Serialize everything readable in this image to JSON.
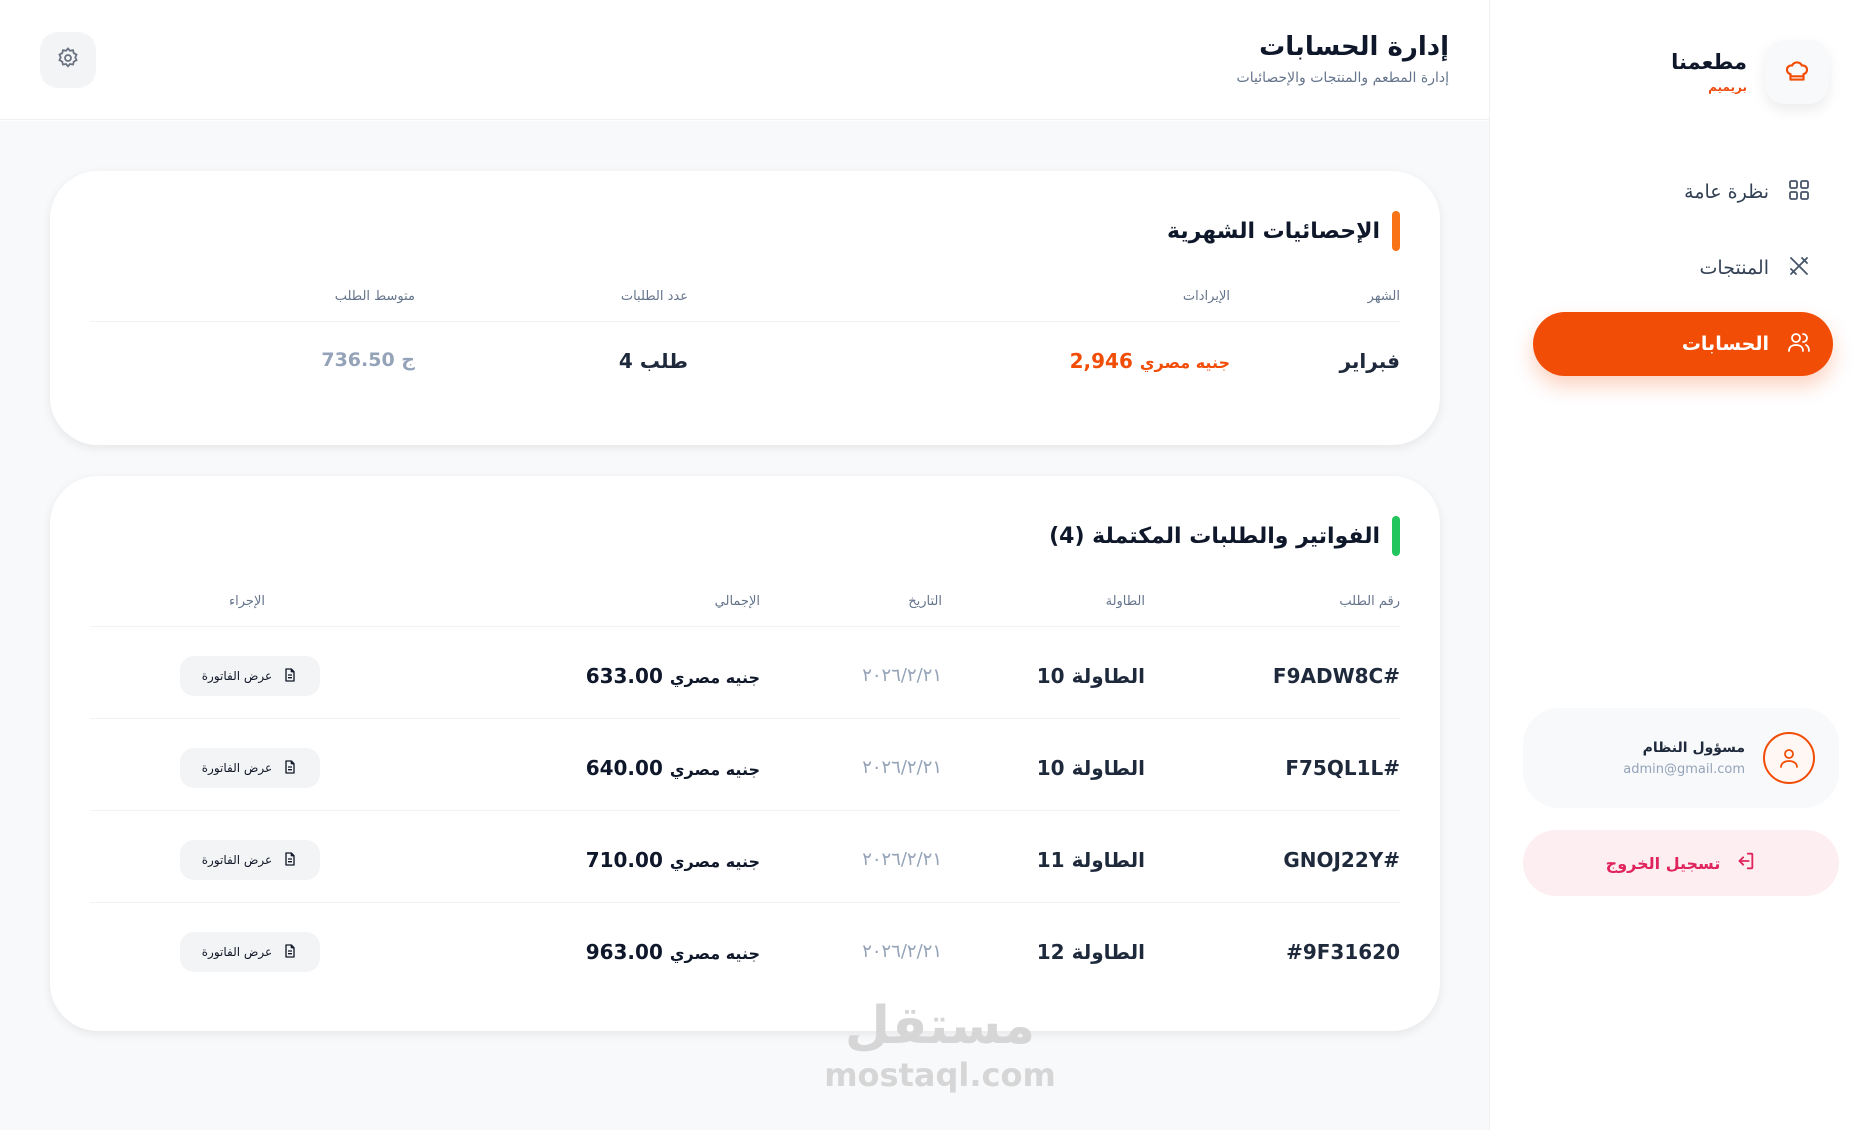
{
  "brand": {
    "name": "مطعمنا",
    "plan": "بريميم"
  },
  "nav": [
    {
      "label": "نظرة عامة",
      "icon": "grid-icon",
      "active": false
    },
    {
      "label": "المنتجات",
      "icon": "utensils-icon",
      "active": false
    },
    {
      "label": "الحسابات",
      "icon": "users-icon",
      "active": true
    }
  ],
  "user": {
    "name": "مسؤول النظام",
    "email": "admin@gmail.com"
  },
  "logout": {
    "label": "تسجيل الخروج"
  },
  "header": {
    "title": "إدارة الحسابات",
    "subtitle": "إدارة المطعم والمنتجات والإحصائيات"
  },
  "stats": {
    "title": "الإحصائيات الشهرية",
    "accent": "#f97316",
    "headers": {
      "month": "الشهر",
      "revenue": "الإيرادات",
      "orders": "عدد الطلبات",
      "avg": "متوسط الطلب"
    },
    "row": {
      "month": "فبراير",
      "revenue": "2,946",
      "revenue_unit": "جنيه مصري",
      "orders": "4 طلب",
      "avg": "736.50 ج"
    }
  },
  "orders": {
    "title": "الفواتير والطلبات المكتملة (4)",
    "accent": "#22c55e",
    "headers": {
      "id": "رقم الطلب",
      "table": "الطاولة",
      "date": "التاريخ",
      "total": "الإجمالي",
      "action": "الإجراء"
    },
    "rows": [
      {
        "id": "F9ADW8C#",
        "table": "الطاولة 10",
        "date": "٢٠٢٦/٢/٢١",
        "total": "633.00",
        "unit": "جنيه مصري",
        "action": "عرض الفاتورة"
      },
      {
        "id": "F75QL1L#",
        "table": "الطاولة 10",
        "date": "٢٠٢٦/٢/٢١",
        "total": "640.00",
        "unit": "جنيه مصري",
        "action": "عرض الفاتورة"
      },
      {
        "id": "GNOJ22Y#",
        "table": "الطاولة 11",
        "date": "٢٠٢٦/٢/٢١",
        "total": "710.00",
        "unit": "جنيه مصري",
        "action": "عرض الفاتورة"
      },
      {
        "id": "#9F31620",
        "table": "الطاولة 12",
        "date": "٢٠٢٦/٢/٢١",
        "total": "963.00",
        "unit": "جنيه مصري",
        "action": "عرض الفاتورة"
      }
    ]
  },
  "watermark": {
    "ar": "مستقل",
    "en": "mostaql.com"
  }
}
